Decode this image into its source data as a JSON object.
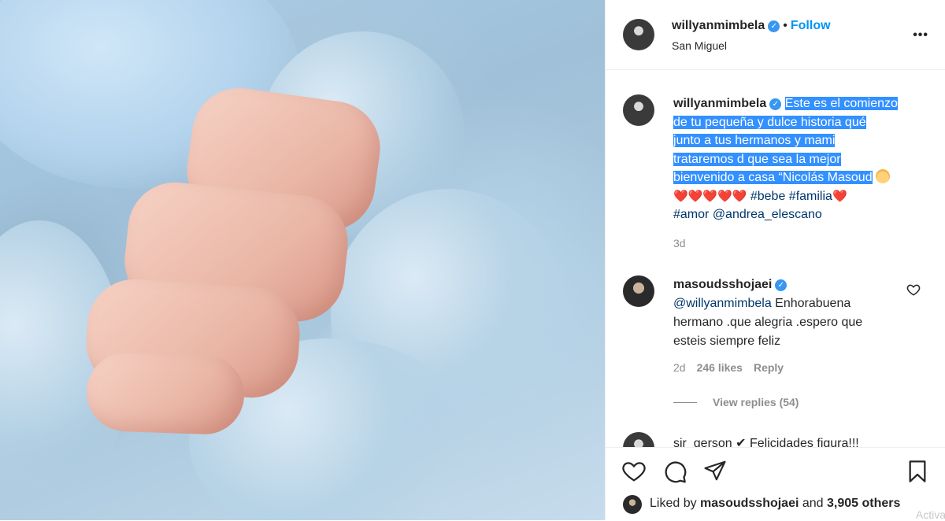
{
  "post": {
    "username": "willyanmimbela",
    "follow_label": "Follow",
    "location": "San Miguel",
    "more_label": "•••"
  },
  "caption": {
    "username": "willyanmimbela",
    "line1": "Este es el comienzo",
    "line2": "de tu pequeña y dulce historia qué",
    "line3": "junto a tus hermanos y mami",
    "line4": "trataremos d que sea la mejor",
    "line5": "bienvenido a casa “Nicolás Masoud",
    "hearts": "❤️❤️❤️❤️❤️",
    "hashtag1": "#bebe",
    "hashtag2": "#familia",
    "heart_end": "❤️",
    "hashtag3": "#amor",
    "mention": "@andrea_elescano",
    "time": "3d"
  },
  "comment": {
    "username": "masoudsshojaei",
    "mention": "@willyanmimbela",
    "text1": " Enhorabuena",
    "text2": "hermano .que alegria .espero que",
    "text3": "esteis siempre feliz",
    "time": "2d",
    "likes": "246 likes",
    "reply_label": "Reply",
    "view_replies": "View replies (54)"
  },
  "next_comment": {
    "text": "sir_gerson ✔ Felicidades figura!!!"
  },
  "likes": {
    "prefix": "Liked by ",
    "user": "masoudsshojaei",
    "middle": " and ",
    "count": "3,905 others"
  },
  "watermark": "Activa",
  "colors": {
    "accent": "#0095f6",
    "verified": "#3897f0",
    "selection": "#3390ff",
    "link": "#00376b"
  }
}
